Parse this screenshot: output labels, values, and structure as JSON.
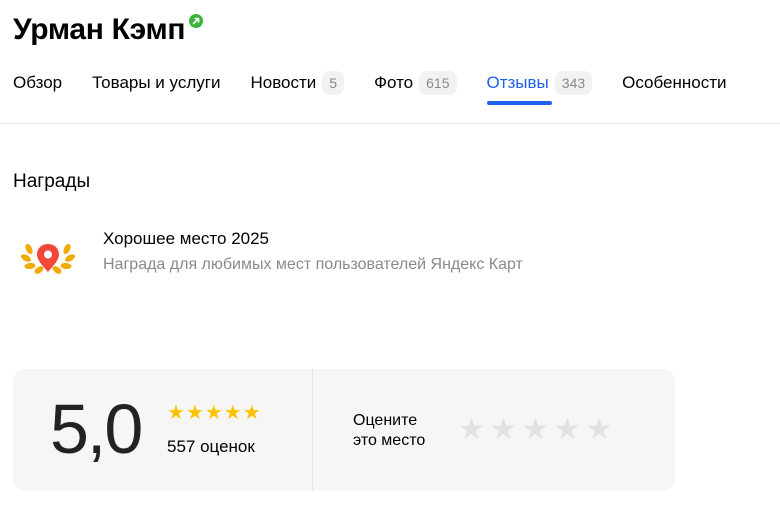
{
  "header": {
    "title": "Урман Кэмп"
  },
  "tabs": [
    {
      "label": "Обзор",
      "count": ""
    },
    {
      "label": "Товары и услуги",
      "count": ""
    },
    {
      "label": "Новости",
      "count": "5"
    },
    {
      "label": "Фото",
      "count": "615"
    },
    {
      "label": "Отзывы",
      "count": "343"
    },
    {
      "label": "Особенности",
      "count": ""
    }
  ],
  "active_tab": "Отзывы",
  "awards": {
    "title": "Награды",
    "item": {
      "name": "Хорошее место 2025",
      "description": "Награда для любимых мест пользователей Яндекс Карт"
    }
  },
  "rating": {
    "value": "5,0",
    "stars_filled": 5,
    "stars_total": 5,
    "count_label": "557 оценок",
    "rate_prompt_line1": "Оцените",
    "rate_prompt_line2": "это место"
  },
  "colors": {
    "accent": "#1e62eb",
    "star": "#fcc400",
    "verified": "#3bb33b"
  }
}
